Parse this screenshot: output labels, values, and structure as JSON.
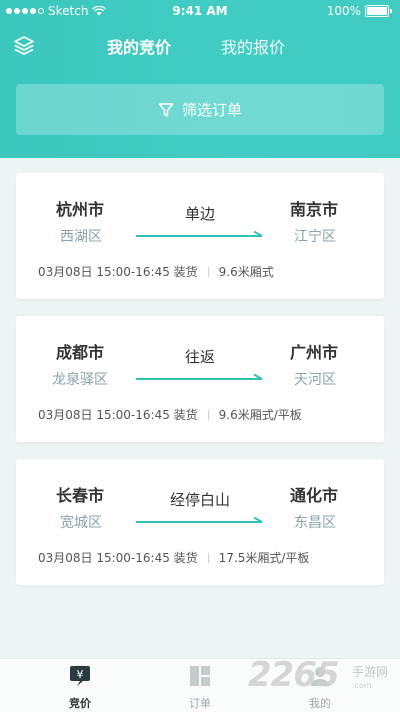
{
  "status_bar": {
    "carrier": "Sketch",
    "time": "9:41 AM",
    "battery": "100%"
  },
  "header": {
    "tabs": [
      {
        "label": "我的竞价",
        "active": true
      },
      {
        "label": "我的报价",
        "active": false
      }
    ],
    "filter_label": "筛选订单"
  },
  "orders": [
    {
      "from_city": "杭州市",
      "from_district": "西湖区",
      "route_type": "单边",
      "to_city": "南京市",
      "to_district": "江宁区",
      "schedule": "03月08日 15:00-16:45 装货",
      "vehicle": "9.6米厢式"
    },
    {
      "from_city": "成都市",
      "from_district": "龙泉驿区",
      "route_type": "往返",
      "to_city": "广州市",
      "to_district": "天河区",
      "schedule": "03月08日 15:00-16:45 装货",
      "vehicle": "9.6米厢式/平板"
    },
    {
      "from_city": "长春市",
      "from_district": "宽城区",
      "route_type": "经停白山",
      "to_city": "通化市",
      "to_district": "东昌区",
      "schedule": "03月08日 15:00-16:45 装货",
      "vehicle": "17.5米厢式/平板"
    }
  ],
  "tabbar": [
    {
      "label": "竞价",
      "icon": "yen-tag-icon",
      "active": true
    },
    {
      "label": "订单",
      "icon": "orders-grid-icon",
      "active": false
    },
    {
      "label": "我的",
      "icon": "profile-icon",
      "active": false
    }
  ],
  "watermark": {
    "number": "2265",
    "site": "手游网",
    "url": ".com"
  },
  "colors": {
    "accent": "#3fcbc1",
    "arrow": "#2fc3b8",
    "district": "#8aa3ab"
  }
}
